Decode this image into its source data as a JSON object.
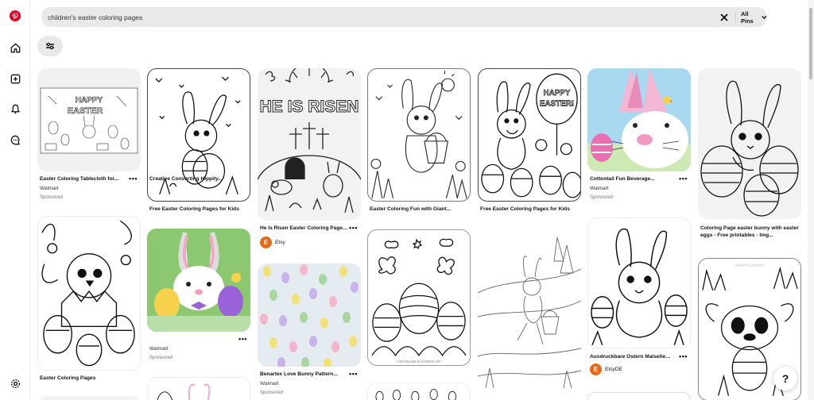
{
  "search": {
    "query": "children's easter coloring pages",
    "scope_label": "All Pins"
  },
  "nav": {
    "items": [
      "pinterest-logo",
      "home",
      "create",
      "notifications",
      "messages",
      "settings"
    ]
  },
  "colors": {
    "brand": "#e60023",
    "etsy": "#e46a1a"
  },
  "pins": [
    {
      "title": "Easter Coloring Tablecloth for...",
      "source": "Walmart",
      "sponsored": "Sponsored"
    },
    {
      "title": "Easter Coloring Pages"
    },
    {
      "title": "Free Easter Coloring Pages for Kids"
    },
    {
      "title": "Creative Converting Hippity...",
      "source": "Walmart",
      "sponsored": "Sponsored"
    },
    {
      "title": "He Is Risen Easter Coloring Page f...",
      "avatar_letter": "E",
      "avatar_name": "Etsy",
      "image_text": "HE IS RISEN"
    },
    {
      "title": "Benartex Love Bunny Pattern...",
      "source": "Walmart",
      "sponsored": "Sponsored"
    },
    {
      "title": "Easter Coloring Fun with Giant..."
    },
    {
      "image_caption": "Coloring page by artofpixel.com"
    },
    {
      "title": "Free Easter Coloring Pages for Kids",
      "image_text_1": "HAPPY",
      "image_text_2": "EASTER!"
    },
    {
      "title": "Cottontail Fun Beverage...",
      "source": "Walmart",
      "sponsored": "Sponsored"
    },
    {
      "title": "Ausdruckbare Ostern Malseiten fü...",
      "avatar_letter": "E",
      "avatar_name": "EtsyDE"
    },
    {
      "title": "Coloring Page easter bunny with easter eggs - Free printables - Img..."
    },
    {
      "image_text": "HAPPY EASTER"
    }
  ],
  "more_glyph": "•••",
  "help_glyph": "?"
}
